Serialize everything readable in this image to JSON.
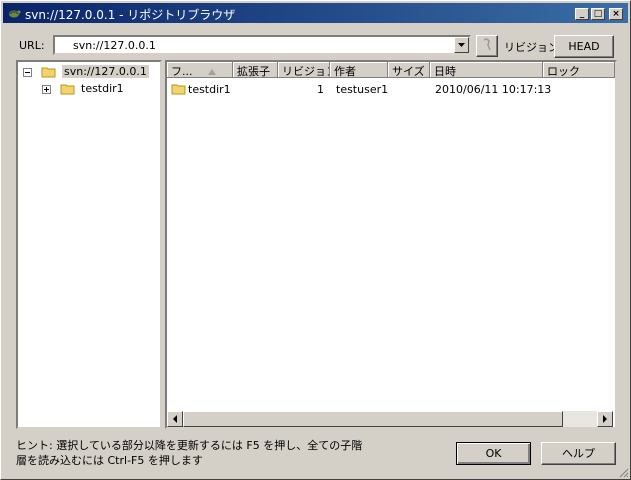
{
  "window": {
    "title": "svn://127.0.0.1 - リポジトリブラウザ"
  },
  "toolbar": {
    "url_label": "URL:",
    "url_value": "svn://127.0.0.1",
    "revision_label": "リビジョン:",
    "head_label": "HEAD"
  },
  "tree": {
    "root": "svn://127.0.0.1",
    "children": [
      "testdir1"
    ]
  },
  "list": {
    "columns": [
      "フ...",
      "拡張子",
      "リビジョン",
      "作者",
      "サイズ",
      "日時",
      "ロック"
    ],
    "rows": [
      {
        "name": "testdir1",
        "extension": "",
        "revision": "1",
        "author": "testuser1",
        "size": "",
        "date": "2010/06/11 10:17:13",
        "lock": ""
      }
    ]
  },
  "footer": {
    "hint_line1": "ヒント: 選択している部分以降を更新するには F5 を押し、全ての子階",
    "hint_line2": "層を読み込むには Ctrl-F5 を押します",
    "ok_label": "OK",
    "help_label": "ヘルプ"
  }
}
